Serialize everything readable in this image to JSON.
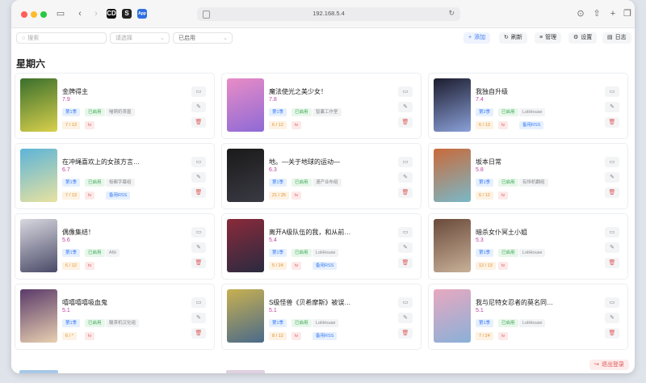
{
  "browser": {
    "url": "192.168.5.4",
    "extensions": [
      "CD",
      "S",
      "App"
    ]
  },
  "toolbar": {
    "search_placeholder": "搜索",
    "select_placeholder": "请选择",
    "filter_value": "已启用",
    "add_label": "添加",
    "refresh_label": "刷新",
    "manage_label": "管理",
    "settings_label": "设置",
    "log_label": "日志"
  },
  "day_title": "星期六",
  "cards": [
    {
      "title": "金牌得主",
      "rating": "7.9",
      "season": "第1季",
      "status": "已启用",
      "group": "喵萌奶茶屋",
      "progress": "7 / 13",
      "type": "tv",
      "rss": "",
      "cover": [
        "#3a6f2c",
        "#d8d04c"
      ]
    },
    {
      "title": "魔法使光之美少女！",
      "rating": "7.8",
      "season": "第1季",
      "status": "已启用",
      "group": "智囊工作室",
      "progress": "6 / 12",
      "type": "tv",
      "rss": "",
      "cover": [
        "#e98cc6",
        "#8e6ad6"
      ]
    },
    {
      "title": "我独自升级",
      "rating": "7.4",
      "season": "第2季",
      "status": "已启用",
      "group": "LoliHouse",
      "progress": "6 / 13",
      "type": "tv",
      "rss": "备用RSS",
      "cover": [
        "#1c1c2e",
        "#8aa0d8"
      ]
    },
    {
      "title": "在冲绳喜欢上的女孩方言…",
      "rating": "6.7",
      "season": "第1季",
      "status": "已启用",
      "group": "桜都字幕组",
      "progress": "7 / 13",
      "type": "tv",
      "rss": "备用RSS",
      "cover": [
        "#5cb4d8",
        "#e8e2a0"
      ]
    },
    {
      "title": "地。—关于地球的运动—",
      "rating": "6.3",
      "season": "第1季",
      "status": "已启用",
      "group": "漫产业布组",
      "progress": "21 / 25",
      "type": "tv",
      "rss": "",
      "cover": [
        "#1a1a1a",
        "#3a3a44"
      ]
    },
    {
      "title": "坂本日常",
      "rating": "5.8",
      "season": "第1季",
      "status": "已启用",
      "group": "有恒机翻组",
      "progress": "6 / 12",
      "type": "tv",
      "rss": "",
      "cover": [
        "#c96a3a",
        "#7ab8c8"
      ]
    },
    {
      "title": "偶像集结！",
      "rating": "5.6",
      "season": "第1季",
      "status": "已启用",
      "group": "ANi",
      "progress": "6 / 12",
      "type": "tv",
      "rss": "",
      "cover": [
        "#d8d8e0",
        "#4a4a68"
      ]
    },
    {
      "title": "离开A级队伍的我，和从前…",
      "rating": "5.4",
      "season": "第1季",
      "status": "已启用",
      "group": "LoliHouse",
      "progress": "5 / 24",
      "type": "tv",
      "rss": "备用RSS",
      "cover": [
        "#8a2a3a",
        "#2a2a40"
      ]
    },
    {
      "title": "暗杀女仆冥土小姐",
      "rating": "5.3",
      "season": "第1季",
      "status": "已启用",
      "group": "LoliHouse",
      "progress": "12 / 13",
      "type": "tv",
      "rss": "",
      "cover": [
        "#6a4a3a",
        "#c8b098"
      ]
    },
    {
      "title": "嘻嘻嘻嘻吸血鬼",
      "rating": "5.1",
      "season": "第1季",
      "status": "已启用",
      "group": "酸茶机汉化组",
      "progress": "6 / *",
      "type": "tv",
      "rss": "",
      "cover": [
        "#5a3a6a",
        "#e8d0b0"
      ]
    },
    {
      "title": "S级怪兽《贝希摩斯》被误…",
      "rating": "5.1",
      "season": "第1季",
      "status": "已启用",
      "group": "LoliHouse",
      "progress": "8 / 12",
      "type": "tv",
      "rss": "备用RSS",
      "cover": [
        "#c8b050",
        "#4a6a8a"
      ]
    },
    {
      "title": "我与尼特女忍者的莫名同…",
      "rating": "5.1",
      "season": "第1季",
      "status": "已启用",
      "group": "LoliHouse",
      "progress": "7 / 24",
      "type": "tv",
      "rss": "",
      "cover": [
        "#e8a8c0",
        "#8ab0d8"
      ]
    }
  ],
  "logout_label": "退出登录"
}
